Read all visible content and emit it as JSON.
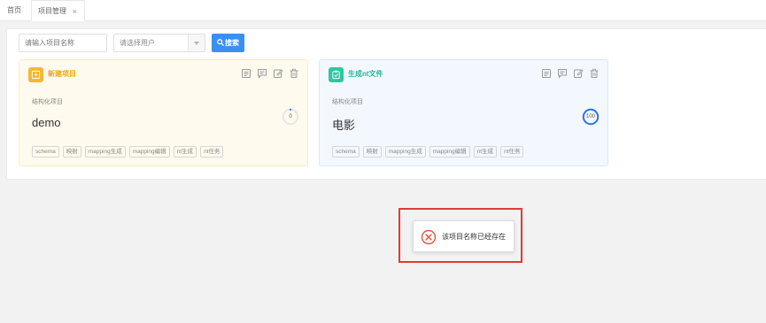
{
  "tabs": {
    "home": "首页",
    "active": "项目管理",
    "close_glyph": "×"
  },
  "filters": {
    "project_name_placeholder": "请输入项目名称",
    "user_select_placeholder": "请选择用户",
    "search_label": "搜索"
  },
  "cards": [
    {
      "title": "新建项目",
      "subtitle": "结构化项目",
      "name": "demo",
      "progress": 0,
      "progress_label": "0",
      "tags": [
        "schema",
        "映射",
        "mapping生成",
        "mapping编辑",
        "nt生成",
        "nt任务"
      ]
    },
    {
      "title": "生成nt文件",
      "subtitle": "结构化项目",
      "name": "电影",
      "progress": 100,
      "progress_label": "100",
      "tags": [
        "schema",
        "映射",
        "mapping生成",
        "mapping编辑",
        "nt生成",
        "nt任务"
      ]
    }
  ],
  "icons": {
    "card1": "lightning-icon",
    "card2": "clipboard-check-icon",
    "actions": [
      "document-icon",
      "comment-icon",
      "edit-icon",
      "delete-icon"
    ],
    "toast": "error-circle-icon"
  },
  "toast": {
    "message": "该项目名称已经存在"
  },
  "colors": {
    "accent_blue": "#3b8ff0",
    "card1_accent": "#f5b82e",
    "card2_accent": "#2fc6a0",
    "error": "#e03a3a"
  }
}
